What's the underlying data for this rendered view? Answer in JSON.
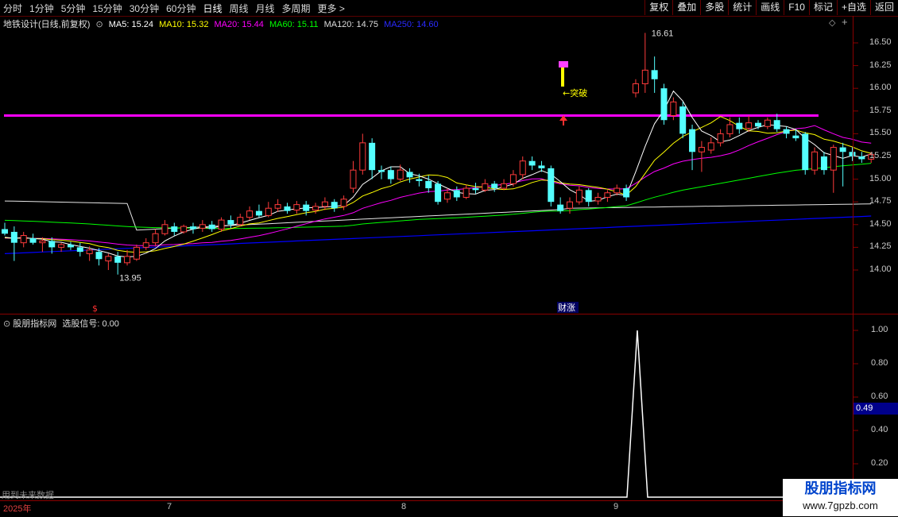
{
  "toolbar": {
    "periods": [
      "分时",
      "1分钟",
      "5分钟",
      "15分钟",
      "30分钟",
      "60分钟",
      "日线",
      "周线",
      "月线",
      "多周期",
      "更多 >"
    ],
    "active_index": 6,
    "buttons": [
      "复权",
      "叠加",
      "多股",
      "统计",
      "画线",
      "F10",
      "标记",
      "+自选",
      "返回"
    ]
  },
  "info": {
    "stock": "地铁设计(日线,前复权)",
    "ma5": "MA5: 15.24",
    "ma10": "MA10: 15.32",
    "ma20": "MA20: 15.44",
    "ma60": "MA60: 15.11",
    "ma120": "MA120: 14.75",
    "ma250": "MA250: 14.60"
  },
  "colors": {
    "up": "#ff3b3b",
    "down": "#54ffff",
    "ma5": "#ffffff",
    "ma10": "#ffff00",
    "ma20": "#ff00ff",
    "ma60": "#00ff00",
    "ma120": "#e6e6e6",
    "ma250": "#0000ff",
    "breakout_line": "#ff00ff"
  },
  "price_axis": [
    "16.50",
    "16.25",
    "16.00",
    "15.75",
    "15.50",
    "15.25",
    "15.00",
    "14.75",
    "14.50",
    "14.25",
    "14.00"
  ],
  "annotations": {
    "high": "16.61",
    "low": "13.95",
    "breakout": "突破",
    "finance": "财涨"
  },
  "indicator": {
    "title": "股朋指标网",
    "value_label": "选股信号: 0.00",
    "axis": [
      "1.00",
      "0.80",
      "0.60",
      "0.40",
      "0.20"
    ],
    "cursor_value": "0.49",
    "future_text": "用到未来数据"
  },
  "dates": [
    "2025年",
    "7",
    "8",
    "9"
  ],
  "watermark": {
    "title": "股朋指标网",
    "url": "www.7gpzb.com"
  },
  "chart_data": {
    "type": "candlestick",
    "ylim": [
      13.85,
      16.8
    ],
    "breakout_level": 15.7,
    "candles": [
      [
        14.45,
        14.4,
        14.52,
        14.38
      ],
      [
        14.42,
        14.3,
        14.48,
        14.1
      ],
      [
        14.3,
        14.38,
        14.42,
        14.25
      ],
      [
        14.35,
        14.3,
        14.4,
        14.28
      ],
      [
        14.3,
        14.32,
        14.36,
        14.2
      ],
      [
        14.32,
        14.25,
        14.36,
        14.18
      ],
      [
        14.25,
        14.28,
        14.3,
        14.2
      ],
      [
        14.28,
        14.25,
        14.31,
        14.22
      ],
      [
        14.25,
        14.2,
        14.3,
        14.15
      ],
      [
        14.18,
        14.22,
        14.26,
        14.1
      ],
      [
        14.2,
        14.12,
        14.24,
        14.05
      ],
      [
        14.1,
        14.15,
        14.18,
        14.0
      ],
      [
        14.15,
        14.08,
        14.2,
        13.95
      ],
      [
        14.08,
        14.15,
        14.22,
        14.05
      ],
      [
        14.12,
        14.25,
        14.28,
        14.1
      ],
      [
        14.25,
        14.3,
        14.35,
        14.22
      ],
      [
        14.3,
        14.4,
        14.45,
        14.26
      ],
      [
        14.4,
        14.5,
        14.55,
        14.38
      ],
      [
        14.48,
        14.42,
        14.52,
        14.38
      ],
      [
        14.42,
        14.48,
        14.5,
        14.4
      ],
      [
        14.48,
        14.45,
        14.52,
        14.4
      ],
      [
        14.46,
        14.5,
        14.55,
        14.42
      ],
      [
        14.5,
        14.45,
        14.54,
        14.42
      ],
      [
        14.45,
        14.55,
        14.58,
        14.42
      ],
      [
        14.55,
        14.5,
        14.6,
        14.46
      ],
      [
        14.5,
        14.58,
        14.62,
        14.48
      ],
      [
        14.58,
        14.65,
        14.7,
        14.55
      ],
      [
        14.65,
        14.6,
        14.72,
        14.58
      ],
      [
        14.6,
        14.68,
        14.75,
        14.58
      ],
      [
        14.68,
        14.72,
        14.78,
        14.64
      ],
      [
        14.7,
        14.65,
        14.74,
        14.62
      ],
      [
        14.66,
        14.72,
        14.76,
        14.62
      ],
      [
        14.72,
        14.65,
        14.76,
        14.6
      ],
      [
        14.66,
        14.7,
        14.74,
        14.62
      ],
      [
        14.7,
        14.75,
        14.8,
        14.66
      ],
      [
        14.75,
        14.68,
        14.78,
        14.64
      ],
      [
        14.7,
        14.78,
        14.82,
        14.66
      ],
      [
        14.9,
        15.1,
        15.2,
        14.85
      ],
      [
        15.1,
        15.4,
        15.5,
        15.05
      ],
      [
        15.4,
        15.1,
        15.45,
        15.0
      ],
      [
        15.1,
        15.08,
        15.15,
        15.0
      ],
      [
        15.1,
        15.0,
        15.14,
        14.95
      ],
      [
        15.0,
        15.1,
        15.16,
        14.98
      ],
      [
        15.08,
        15.02,
        15.12,
        14.96
      ],
      [
        15.0,
        14.98,
        15.06,
        14.92
      ],
      [
        14.98,
        14.9,
        15.04,
        14.85
      ],
      [
        14.95,
        14.75,
        14.98,
        14.72
      ],
      [
        14.78,
        14.85,
        14.9,
        14.74
      ],
      [
        14.88,
        14.8,
        14.92,
        14.76
      ],
      [
        14.8,
        14.9,
        14.94,
        14.78
      ],
      [
        14.9,
        14.88,
        14.96,
        14.84
      ],
      [
        14.88,
        14.95,
        15.0,
        14.86
      ],
      [
        14.95,
        14.9,
        14.98,
        14.86
      ],
      [
        14.9,
        14.95,
        15.0,
        14.88
      ],
      [
        14.95,
        15.05,
        15.1,
        14.92
      ],
      [
        15.05,
        15.2,
        15.25,
        15.0
      ],
      [
        15.2,
        15.15,
        15.25,
        15.1
      ],
      [
        15.15,
        15.12,
        15.2,
        15.08
      ],
      [
        15.12,
        14.75,
        15.15,
        14.7
      ],
      [
        14.72,
        14.65,
        14.8,
        14.62
      ],
      [
        14.68,
        14.75,
        14.8,
        14.62
      ],
      [
        14.75,
        14.88,
        14.92,
        14.72
      ],
      [
        14.88,
        14.75,
        14.9,
        14.7
      ],
      [
        14.76,
        14.8,
        14.85,
        14.72
      ],
      [
        14.8,
        14.85,
        14.88,
        14.75
      ],
      [
        14.85,
        14.9,
        14.94,
        14.82
      ],
      [
        14.9,
        14.8,
        14.94,
        14.76
      ],
      [
        15.95,
        16.05,
        16.1,
        15.9
      ],
      [
        16.05,
        16.2,
        16.61,
        15.95
      ],
      [
        16.2,
        16.1,
        16.35,
        15.95
      ],
      [
        16.0,
        15.65,
        16.05,
        15.6
      ],
      [
        15.7,
        15.85,
        15.9,
        15.65
      ],
      [
        15.8,
        15.5,
        15.85,
        15.45
      ],
      [
        15.55,
        15.3,
        15.6,
        15.1
      ],
      [
        15.3,
        15.35,
        15.42,
        15.08
      ],
      [
        15.32,
        15.4,
        15.46,
        15.28
      ],
      [
        15.4,
        15.5,
        15.55,
        15.36
      ],
      [
        15.5,
        15.6,
        15.68,
        15.46
      ],
      [
        15.62,
        15.55,
        15.68,
        15.5
      ],
      [
        15.56,
        15.62,
        15.7,
        15.52
      ],
      [
        15.62,
        15.58,
        15.65,
        15.55
      ],
      [
        15.58,
        15.65,
        15.68,
        15.55
      ],
      [
        15.65,
        15.55,
        15.72,
        15.52
      ],
      [
        15.55,
        15.5,
        15.58,
        15.45
      ],
      [
        15.48,
        15.45,
        15.55,
        15.42
      ],
      [
        15.5,
        15.1,
        15.52,
        15.05
      ],
      [
        15.1,
        15.3,
        15.35,
        15.05
      ],
      [
        15.25,
        15.1,
        15.3,
        15.05
      ],
      [
        15.1,
        15.35,
        15.38,
        14.85
      ],
      [
        15.35,
        15.3,
        15.4,
        14.92
      ],
      [
        15.3,
        15.25,
        15.35,
        15.2
      ],
      [
        15.25,
        15.22,
        15.3,
        15.18
      ],
      [
        15.22,
        15.27,
        15.3,
        15.18
      ]
    ],
    "signal": {
      "baseline": 0.0,
      "peak_value": 1.0,
      "peak_index": 67
    }
  }
}
